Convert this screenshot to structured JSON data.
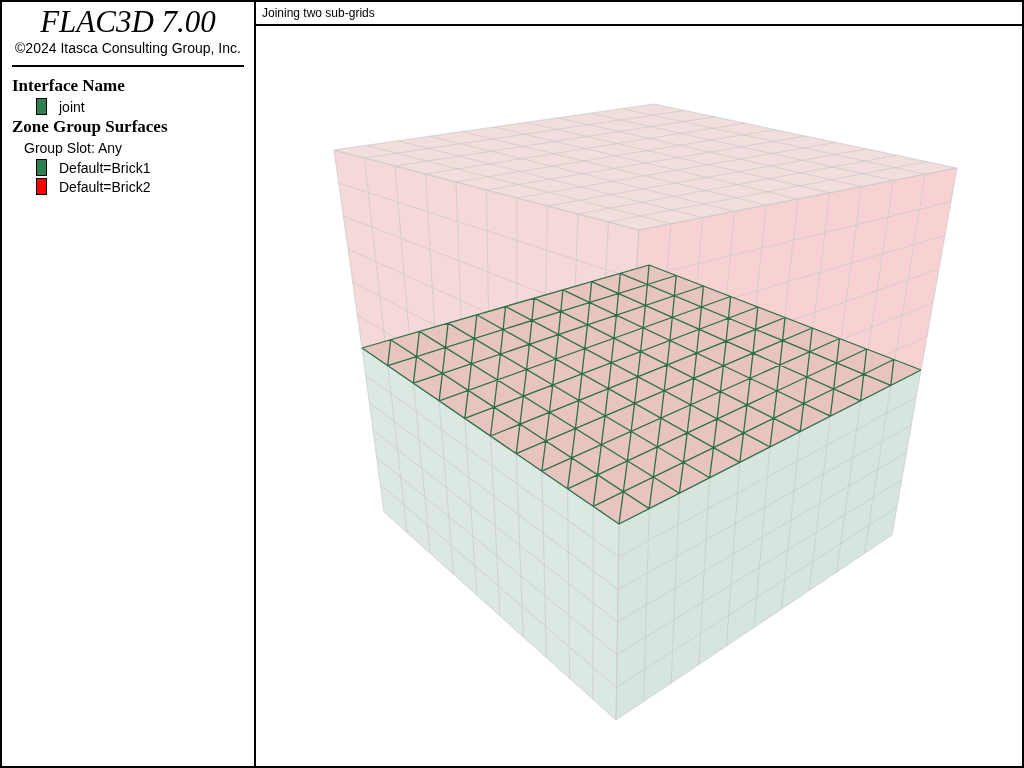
{
  "legend": {
    "title": "FLAC3D 7.00",
    "copyright": "©2024 Itasca Consulting Group, Inc.",
    "sections": [
      {
        "heading": "Interface Name",
        "items": [
          {
            "label": "joint",
            "color": "#2e8050"
          }
        ]
      },
      {
        "heading": "Zone Group Surfaces",
        "subheading": "Group Slot: Any",
        "items": [
          {
            "label": "Default=Brick1",
            "color": "#2e8050"
          },
          {
            "label": "Default=Brick2",
            "color": "#ff0000"
          }
        ]
      }
    ]
  },
  "view": {
    "title": "Joining two sub-grids"
  }
}
